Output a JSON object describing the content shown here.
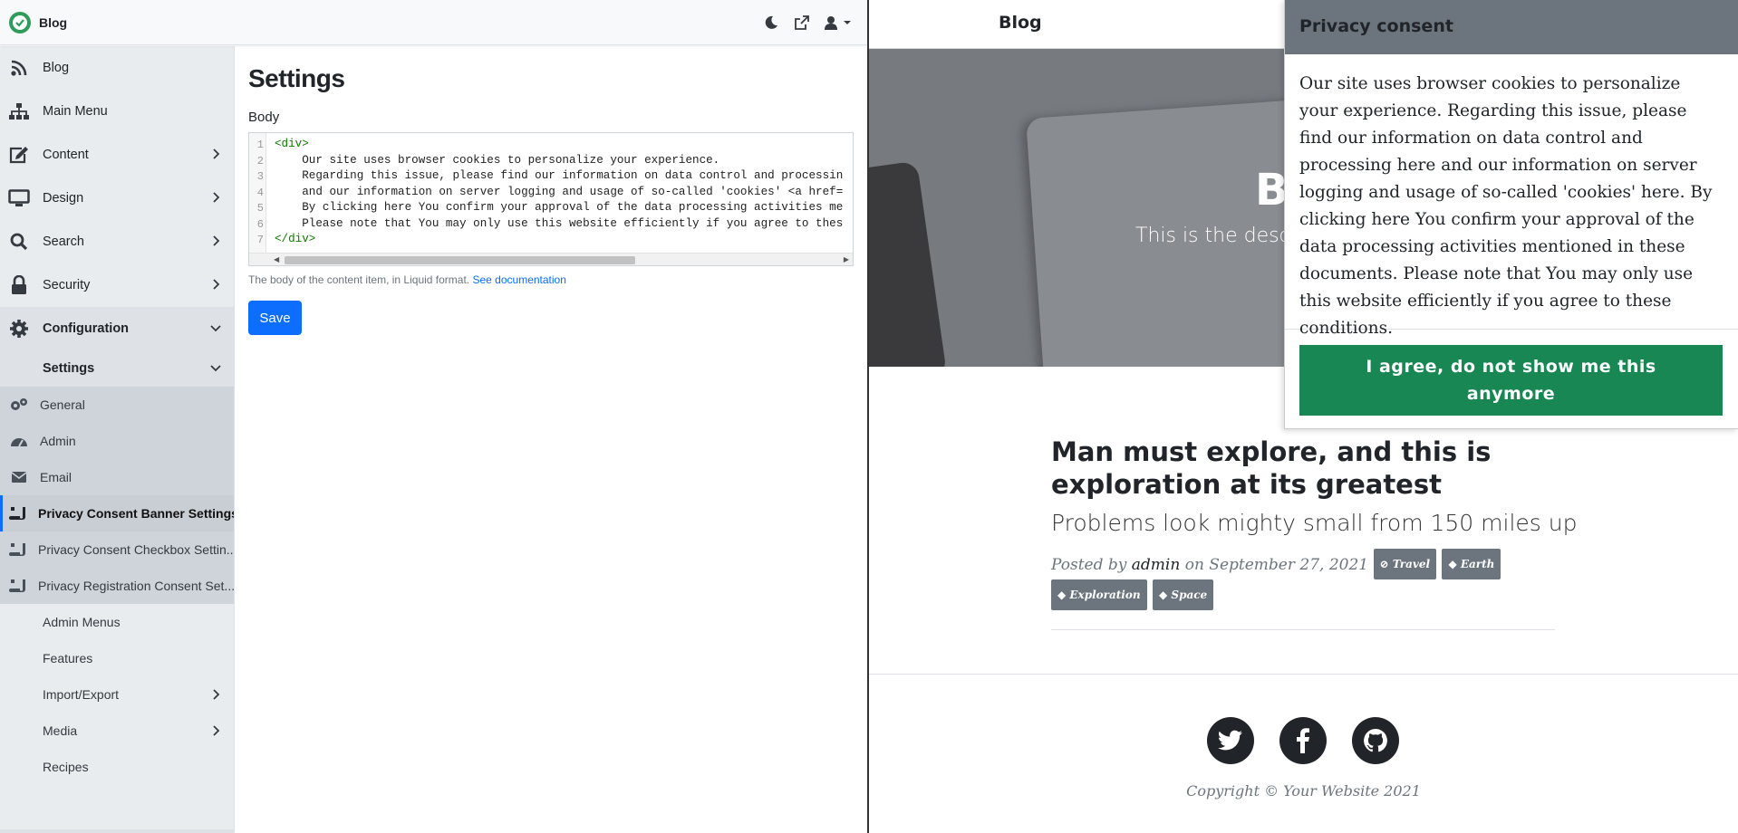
{
  "admin": {
    "brand": "Blog",
    "sidebar": {
      "items": [
        {
          "label": "Blog"
        },
        {
          "label": "Main Menu"
        },
        {
          "label": "Content"
        },
        {
          "label": "Design"
        },
        {
          "label": "Search"
        },
        {
          "label": "Security"
        },
        {
          "label": "Configuration"
        },
        {
          "label": "Settings"
        }
      ],
      "settings_sub": [
        {
          "label": "General"
        },
        {
          "label": "Admin"
        },
        {
          "label": "Email"
        },
        {
          "label": "Privacy Consent Banner Settings"
        },
        {
          "label": "Privacy Consent Checkbox Settin..."
        },
        {
          "label": "Privacy Registration Consent Set..."
        }
      ],
      "config_more": [
        {
          "label": "Admin Menus"
        },
        {
          "label": "Features"
        },
        {
          "label": "Import/Export"
        },
        {
          "label": "Media"
        },
        {
          "label": "Recipes"
        }
      ]
    },
    "page_title": "Settings",
    "body_label": "Body",
    "editor": {
      "line_numbers": [
        "1",
        "2",
        "3",
        "4",
        "5",
        "6",
        "7"
      ],
      "lines": [
        "<div>",
        "    Our site uses browser cookies to personalize your experience.",
        "    Regarding this issue, please find our information on data control and processin",
        "    and our information on server logging and usage of so-called 'cookies' <a href=",
        "    By clicking here You confirm your approval of the data processing activities me",
        "    Please note that You may only use this website efficiently if you agree to thes",
        "</div>"
      ]
    },
    "help_text": "The body of the content item, in Liquid format.",
    "help_link": "See documentation",
    "save_label": "Save"
  },
  "site": {
    "brand": "Blog",
    "hero_title": "B",
    "hero_subtitle": "This is the desc",
    "post": {
      "title": "Man must explore, and this is exploration at its greatest",
      "subtitle": "Problems look mighty small from 150 miles up",
      "posted_by": "Posted by",
      "author": "admin",
      "on_date": "on September 27, 2021",
      "tags": [
        "Travel",
        "Earth",
        "Exploration",
        "Space"
      ]
    },
    "copyright": "Copyright © Your Website 2021"
  },
  "consent": {
    "title": "Privacy consent",
    "body": "Our site uses browser cookies to personalize your experience. Regarding this issue, please find our information on data control and processing here and our information on server logging and usage of so-called 'cookies' here. By clicking here You confirm your approval of the data processing activities mentioned in these documents. Please note that You may only use this website efficiently if you agree to these conditions.",
    "button_label": "I agree, do not show me this anymore"
  },
  "colors": {
    "primary": "#0d6efd",
    "consent_button": "#198754",
    "consent_header": "#6c757d",
    "hero_bg": "#777b80",
    "badge_bg": "#6c757d"
  },
  "icons": [
    "theme-toggle-icon",
    "external-link-icon",
    "user-icon",
    "rss-icon",
    "sitemap-icon",
    "edit-icon",
    "monitor-icon",
    "search-icon",
    "lock-icon",
    "gear-icon",
    "gears-icon",
    "dashboard-icon",
    "envelope-icon",
    "scroll-icon",
    "twitter-icon",
    "facebook-icon",
    "github-icon"
  ]
}
